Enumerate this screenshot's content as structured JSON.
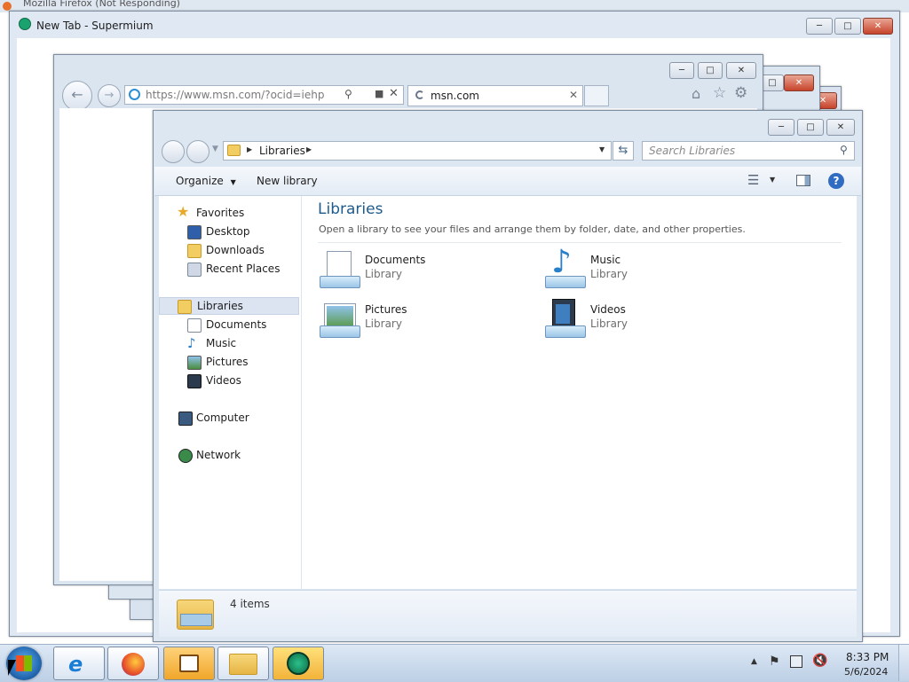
{
  "firefox": {
    "title": "Mozilla Firefox (Not Responding)"
  },
  "supermium": {
    "title": "New Tab - Supermium"
  },
  "ie": {
    "address": "https://www.msn.com/?ocid=iehp",
    "tab_title": "msn.com"
  },
  "explorer": {
    "breadcrumb": [
      "Libraries"
    ],
    "search_placeholder": "Search Libraries",
    "toolbar": {
      "organize": "Organize",
      "new_library": "New library"
    },
    "heading": "Libraries",
    "description": "Open a library to see your files and arrange them by folder, date, and other properties.",
    "nav": {
      "favorites": {
        "label": "Favorites",
        "items": [
          "Desktop",
          "Downloads",
          "Recent Places"
        ]
      },
      "libraries": {
        "label": "Libraries",
        "items": [
          "Documents",
          "Music",
          "Pictures",
          "Videos"
        ]
      },
      "computer": "Computer",
      "network": "Network"
    },
    "libraries": [
      {
        "name": "Documents",
        "type": "Library"
      },
      {
        "name": "Music",
        "type": "Library"
      },
      {
        "name": "Pictures",
        "type": "Library"
      },
      {
        "name": "Videos",
        "type": "Library"
      }
    ],
    "status": "4 items"
  },
  "taskbar": {
    "time": "8:33 PM",
    "date": "5/6/2024",
    "apps": [
      "internet-explorer",
      "firefox",
      "media-player",
      "windows-explorer",
      "supermium"
    ]
  },
  "colors": {
    "heading": "#1e5b8c",
    "taskbar": "#c9d9ec",
    "selected_nav": "#dbe4f0"
  }
}
